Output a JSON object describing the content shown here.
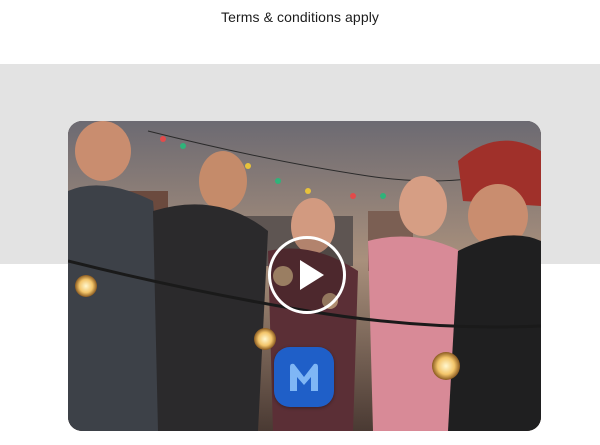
{
  "terms_text": "Terms & conditions apply",
  "colors": {
    "band": "#e3e3e3",
    "logo_bg": "#1f5fc8",
    "logo_fg": "#7fb6f5"
  },
  "video": {
    "play_icon": "play-icon",
    "logo_icon": "m-logo-icon"
  }
}
